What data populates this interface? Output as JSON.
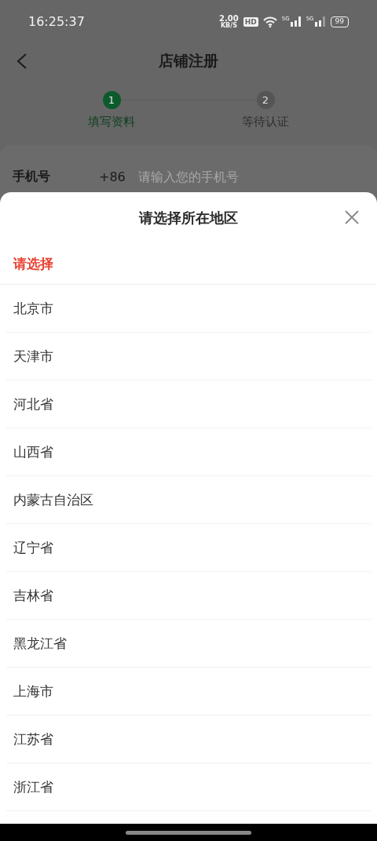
{
  "status_bar": {
    "time": "16:25:37",
    "net_speed": "2.00",
    "net_unit": "KB/S",
    "hd": "HD",
    "signal_1": "5G",
    "signal_2": "5G",
    "battery": "99"
  },
  "header": {
    "title": "店铺注册"
  },
  "steps": [
    {
      "number": "1",
      "label": "填写资料",
      "selected": true
    },
    {
      "number": "2",
      "label": "等待认证",
      "selected": false
    }
  ],
  "form": {
    "label": "手机号",
    "prefix": "+86",
    "placeholder": "请输入您的手机号"
  },
  "sheet": {
    "title": "请选择所在地区",
    "tabs": [
      {
        "label": "请选择",
        "selected": true
      }
    ],
    "items": [
      "北京市",
      "天津市",
      "河北省",
      "山西省",
      "内蒙古自治区",
      "辽宁省",
      "吉林省",
      "黑龙江省",
      "上海市",
      "江苏省",
      "浙江省"
    ]
  }
}
